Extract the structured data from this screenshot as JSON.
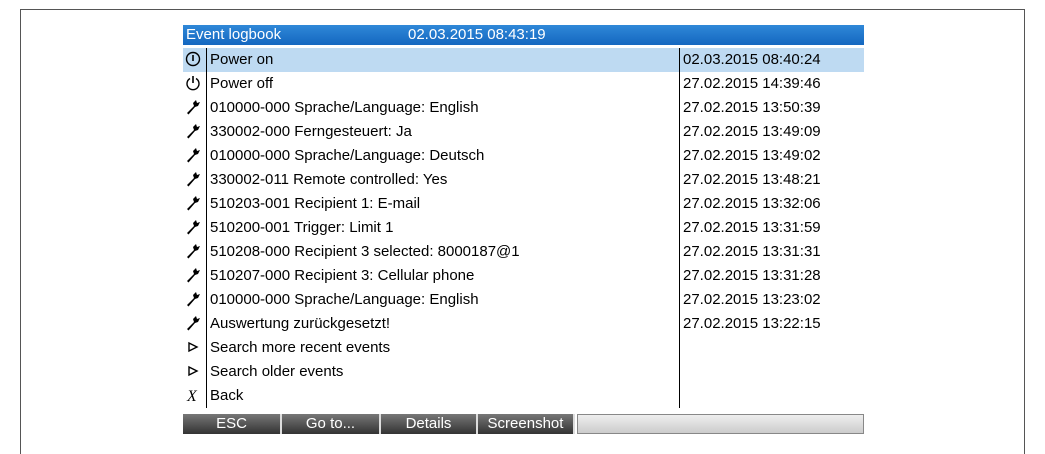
{
  "title": "Event logbook",
  "datetime": "02.03.2015 08:43:19",
  "events": [
    {
      "icon": "power-on-icon",
      "label": "Power on",
      "time": "02.03.2015 08:40:24",
      "selected": true
    },
    {
      "icon": "power-off-icon",
      "label": "Power off",
      "time": "27.02.2015 14:39:46"
    },
    {
      "icon": "wrench-icon",
      "label": "010000-000 Sprache/Language: English",
      "time": "27.02.2015 13:50:39"
    },
    {
      "icon": "wrench-icon",
      "label": "330002-000 Ferngesteuert: Ja",
      "time": "27.02.2015 13:49:09"
    },
    {
      "icon": "wrench-icon",
      "label": "010000-000 Sprache/Language: Deutsch",
      "time": "27.02.2015 13:49:02"
    },
    {
      "icon": "wrench-icon",
      "label": "330002-011 Remote controlled: Yes",
      "time": "27.02.2015 13:48:21"
    },
    {
      "icon": "wrench-icon",
      "label": "510203-001 Recipient 1: E-mail",
      "time": "27.02.2015 13:32:06"
    },
    {
      "icon": "wrench-icon",
      "label": "510200-001 Trigger: Limit 1",
      "time": "27.02.2015 13:31:59"
    },
    {
      "icon": "wrench-icon",
      "label": "510208-000 Recipient 3 selected: 8000187@1",
      "time": "27.02.2015 13:31:31"
    },
    {
      "icon": "wrench-icon",
      "label": "510207-000 Recipient 3: Cellular phone",
      "time": "27.02.2015 13:31:28"
    },
    {
      "icon": "wrench-icon",
      "label": "010000-000 Sprache/Language: English",
      "time": "27.02.2015 13:23:02"
    },
    {
      "icon": "wrench-icon",
      "label": "Auswertung zurückgesetzt!",
      "time": "27.02.2015 13:22:15"
    },
    {
      "icon": "play-icon",
      "label": "Search more recent events",
      "time": ""
    },
    {
      "icon": "play-icon",
      "label": "Search older events",
      "time": ""
    },
    {
      "icon": "back-icon",
      "label": "Back",
      "time": ""
    }
  ],
  "softkeys": [
    "ESC",
    "Go to...",
    "Details",
    "Screenshot",
    ""
  ],
  "colors": {
    "title_bg": "#1f78cf",
    "selection": "#bedaf2"
  }
}
